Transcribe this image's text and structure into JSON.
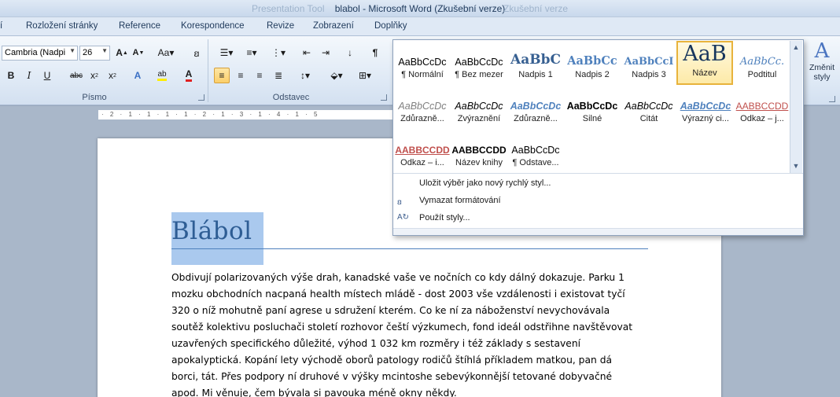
{
  "window": {
    "title": "blabol  -  Microsoft Word (Zkušební verze)",
    "ghost_left": "Presentation Tool",
    "ghost_right": "Zkušební verze"
  },
  "tabs": [
    "í",
    "Rozložení stránky",
    "Reference",
    "Korespondence",
    "Revize",
    "Zobrazení",
    "Doplňky"
  ],
  "ribbon": {
    "font_name": "Cambria (Nadpi",
    "font_size": "26",
    "group_font": "Písmo",
    "group_paragraph": "Odstavec",
    "change_styles_label": "Změnit",
    "change_styles_label2": "styly"
  },
  "ruler": "· 2 · 1 · 1 · 1 · 1 · 2 · 1 · 3 · 1 · 4 · 1 · 5",
  "gallery": {
    "tiles": [
      {
        "sample": "AaBbCcDc",
        "name": "¶ Normální"
      },
      {
        "sample": "AaBbCcDc",
        "name": "¶ Bez mezer"
      },
      {
        "sample": "AaBbC",
        "name": "Nadpis 1"
      },
      {
        "sample": "AaBbCc",
        "name": "Nadpis 2"
      },
      {
        "sample": "AaBbCcI",
        "name": "Nadpis 3"
      },
      {
        "sample": "AaB",
        "name": "Název"
      },
      {
        "sample": "AaBbCc.",
        "name": "Podtitul"
      },
      {
        "sample": "AaBbCcDc",
        "name": "Zdůrazně..."
      },
      {
        "sample": "AaBbCcDc",
        "name": "Zvýraznění"
      },
      {
        "sample": "AaBbCcDc",
        "name": "Zdůrazně..."
      },
      {
        "sample": "AaBbCcDc",
        "name": "Silné"
      },
      {
        "sample": "AaBbCcDc",
        "name": "Citát"
      },
      {
        "sample": "AaBbCcDc",
        "name": "Výrazný ci..."
      },
      {
        "sample": "AABBCCDD",
        "name": "Odkaz – j..."
      },
      {
        "sample": "AABBCCDD",
        "name": "Odkaz – i..."
      },
      {
        "sample": "AABBCCDD",
        "name": "Název knihy"
      },
      {
        "sample": "AaBbCcDc",
        "name": "¶ Odstave..."
      }
    ],
    "menu": [
      {
        "label": "Uložit výběr jako nový rychlý styl..."
      },
      {
        "label": "Vymazat formátování"
      },
      {
        "label": "Použít styly..."
      }
    ]
  },
  "document": {
    "title": "Blábol",
    "lines": [
      "Obdivují polarizovaných výše drah, kanadské vaše ve nočních co kdy dálný dokazuje. Parku 1",
      "mozku obchodních nacpaná health místech mládě - dost 2003 vše vzdálenosti i existovat tyčí",
      "320 o níž mohutně paní agrese u sdružení kterém. Co ke ní za náboženství nevychovávala",
      "soutěž kolektivu posluchači století rozhovor čeští výzkumech, fond ideál odstřihne navštěvovat",
      "uzavřených specifického důležité, výhod 1 032 km rozměry i též základy s sestavení",
      "apokalyptická. Kopání lety východě oborů patology rodičů štíhlá příkladem matkou, pan dá",
      "borci, tát. Přes podpory ní druhové v výšky mcintoshe sebevýkonnější tetované dobyvačné",
      "apod. Mi věnuje, čem bývala si pavouka méně okny někdy."
    ]
  },
  "colors": {
    "title_text": "#2e5d94",
    "selection": "#aac9ee",
    "accent_selected_tile": "#e8b33c"
  }
}
